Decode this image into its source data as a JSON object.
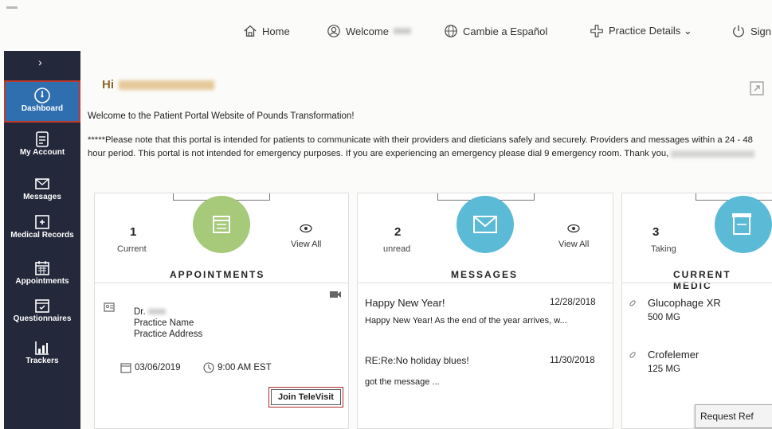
{
  "topnav": {
    "home": "Home",
    "welcome": "Welcome",
    "language": "Cambie a Español",
    "practice": "Practice Details ⌄",
    "sign": "Sign"
  },
  "sidebar": {
    "items": [
      {
        "label": "Dashboard",
        "icon": "dashboard-icon"
      },
      {
        "label": "My Account",
        "icon": "account-icon"
      },
      {
        "label": "Messages",
        "icon": "messages-icon"
      },
      {
        "label": "Medical Records",
        "icon": "medical-records-icon"
      },
      {
        "label": "Appointments",
        "icon": "calendar-icon"
      },
      {
        "label": "Questionnaires",
        "icon": "questionnaire-icon"
      },
      {
        "label": "Trackers",
        "icon": "chart-icon"
      }
    ],
    "expand": "›"
  },
  "greeting": "Hi",
  "welcome_line": "Welcome to the Patient Portal Website of Pounds Transformation!",
  "notice": "*****Please note that this portal is intended for patients to communicate with their providers and dieticians safely and securely. Providers and messages within a 24 - 48 hour period. This portal is not intended for emergency purposes. If you are experiencing an emergency please dial 9 emergency room. Thank you,",
  "appointments": {
    "count": "1",
    "count_label": "Current",
    "view_all": "View All",
    "title": "APPOINTMENTS",
    "doctor": "Dr.",
    "practice_name": "Practice Name",
    "practice_address": "Practice Address",
    "date": "03/06/2019",
    "time": "9:00 AM EST",
    "televisit": "Join TeleVisit",
    "accent": "#a6c97a"
  },
  "messages": {
    "count": "2",
    "count_label": "unread",
    "view_all": "View All",
    "title": "MESSAGES",
    "accent": "#5bbad5",
    "items": [
      {
        "subject": "Happy New Year!",
        "date": "12/28/2018",
        "preview": "Happy New Year! As the end of the year arrives, w..."
      },
      {
        "subject": "RE:Re:No holiday blues!",
        "date": "11/30/2018",
        "preview": "got the message ..."
      }
    ]
  },
  "medications": {
    "count": "3",
    "count_label": "Taking",
    "title": "CURRENT MEDIC",
    "accent": "#5bbad5",
    "items": [
      {
        "name": "Glucophage XR",
        "dose": "500 MG"
      },
      {
        "name": "Crofelemer",
        "dose": "125 MG"
      }
    ],
    "request": "Request Ref"
  }
}
